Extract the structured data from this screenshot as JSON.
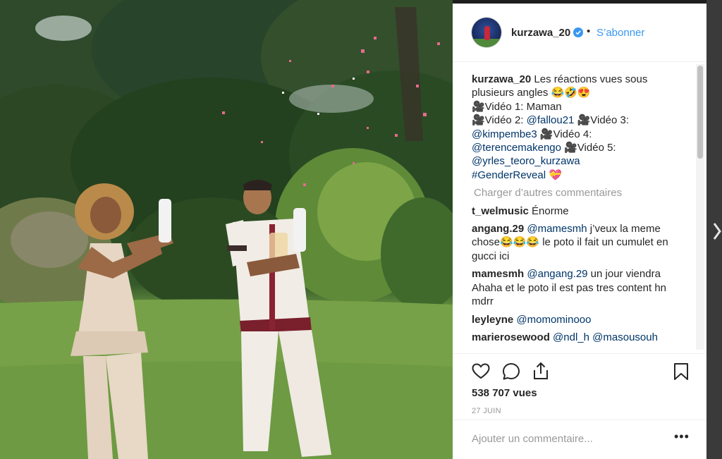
{
  "post": {
    "author": {
      "username": "kurzawa_20",
      "follow_label": "S’abonner",
      "separator": "•",
      "avatar_icon": "profile-avatar",
      "verified_icon": "verified-badge-icon"
    },
    "caption": {
      "username": "kurzawa_20",
      "line1": "Les réactions vues sous plusieurs angles 😂🤣😍",
      "line2": "🎥Vidéo 1: Maman",
      "line3_prefix": "🎥Vidéo 2: ",
      "mention_fallou": "@fallou21",
      "line3_mid": " 🎥Vidéo 3: ",
      "mention_kimpembe": "@kimpembe3",
      "line4_mid": " 🎥Vidéo 4: ",
      "mention_terence": "@terencemakengo",
      "line5_mid": " 🎥Vidéo 5: ",
      "mention_yrles": "@yrles_teoro_kurzawa",
      "hashtag": "#GenderReveal",
      "hashtag_emoji": "💝"
    },
    "load_more_label": "Charger d’autres commentaires",
    "comments": [
      {
        "user": "t_welmusic",
        "parts": [
          {
            "text": "Énorme"
          }
        ]
      },
      {
        "user": "angang.29",
        "parts": [
          {
            "mention": "@mamesmh"
          },
          {
            "text": " j’veux la meme chose😂😂😂 le poto il fait un cumulet en gucci ici"
          }
        ]
      },
      {
        "user": "mamesmh",
        "parts": [
          {
            "mention": "@angang.29"
          },
          {
            "text": " un jour viendra Ahaha et le poto il est pas tres content hn mdrr"
          }
        ]
      },
      {
        "user": "leyleyne",
        "parts": [
          {
            "mention": "@momominooo"
          }
        ]
      },
      {
        "user": "marierosewood",
        "parts": [
          {
            "mention": "@ndl_h"
          },
          {
            "text": " "
          },
          {
            "mention": "@masousouh"
          }
        ]
      }
    ],
    "stats": {
      "views": "538 707 vues",
      "date": "27 JUIN"
    },
    "composer": {
      "placeholder": "Ajouter un commentaire...",
      "more_label": "•••"
    }
  },
  "icons": [
    "heart-icon",
    "comment-icon",
    "share-icon",
    "bookmark-icon",
    "next-arrow-icon"
  ],
  "colors": {
    "link": "#003569",
    "follow": "#3897f0",
    "text": "#262626",
    "muted": "#999999"
  }
}
